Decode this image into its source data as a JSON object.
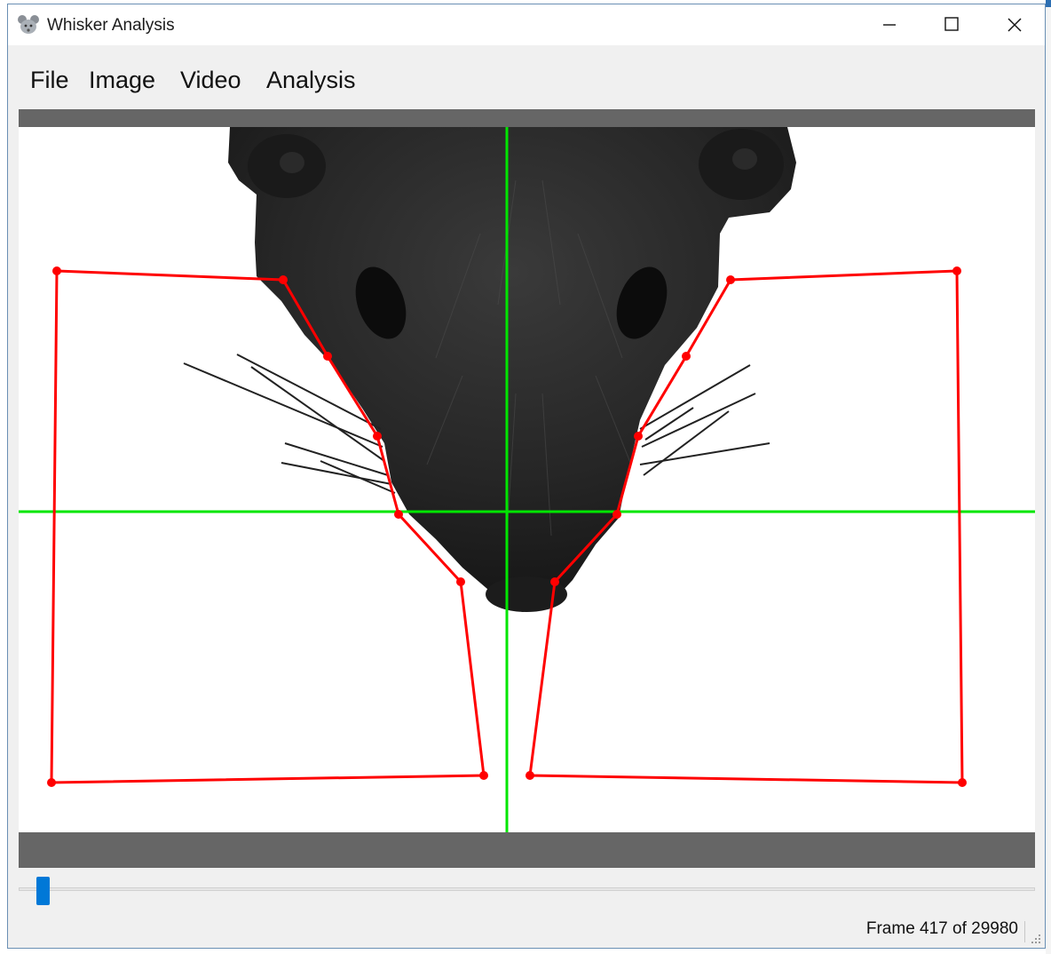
{
  "window": {
    "title": "Whisker Analysis",
    "app_icon": "mouse-icon",
    "controls": [
      "minimize-icon",
      "maximize-icon",
      "close-icon"
    ]
  },
  "menu": {
    "items": [
      {
        "label": "File"
      },
      {
        "label": "Image"
      },
      {
        "label": "Video"
      },
      {
        "label": "Analysis"
      }
    ]
  },
  "viewer": {
    "overlay_colors": {
      "crosshair": "#00e600",
      "roi": "#ff0000",
      "background": "#666666"
    },
    "image_description_icon": "mouse-head-image"
  },
  "timeline": {
    "current_frame": 417,
    "total_frames": 29980,
    "position_fraction": 0.0139
  },
  "status": {
    "text": "Frame 417 of 29980"
  }
}
